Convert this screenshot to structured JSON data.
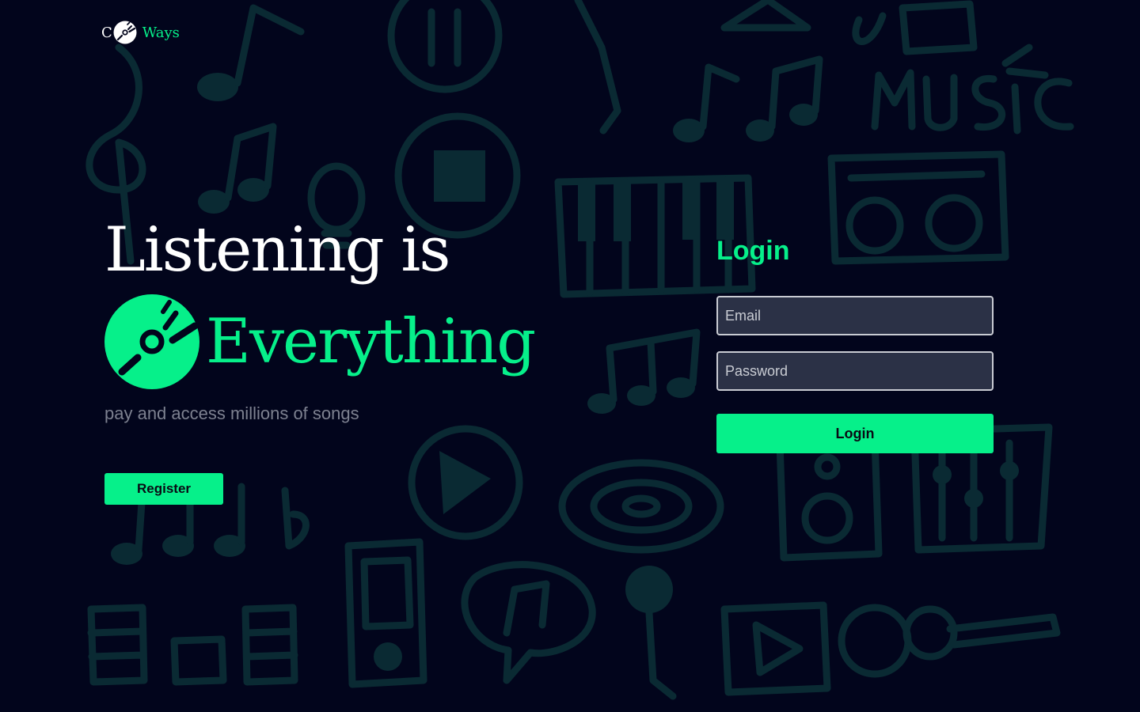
{
  "brand": {
    "prefix": "C",
    "suffix": "Ways",
    "disc_icon": "disc-icon"
  },
  "hero": {
    "line1": "Listening is",
    "line2": "Everything",
    "tagline": "pay and access millions of songs",
    "register_label": "Register"
  },
  "login": {
    "title": "Login",
    "email_placeholder": "Email",
    "password_placeholder": "Password",
    "submit_label": "Login"
  },
  "colors": {
    "background": "#02051c",
    "accent": "#06f08a",
    "doodle": "#0a2a33",
    "muted_text": "#7d8190"
  }
}
